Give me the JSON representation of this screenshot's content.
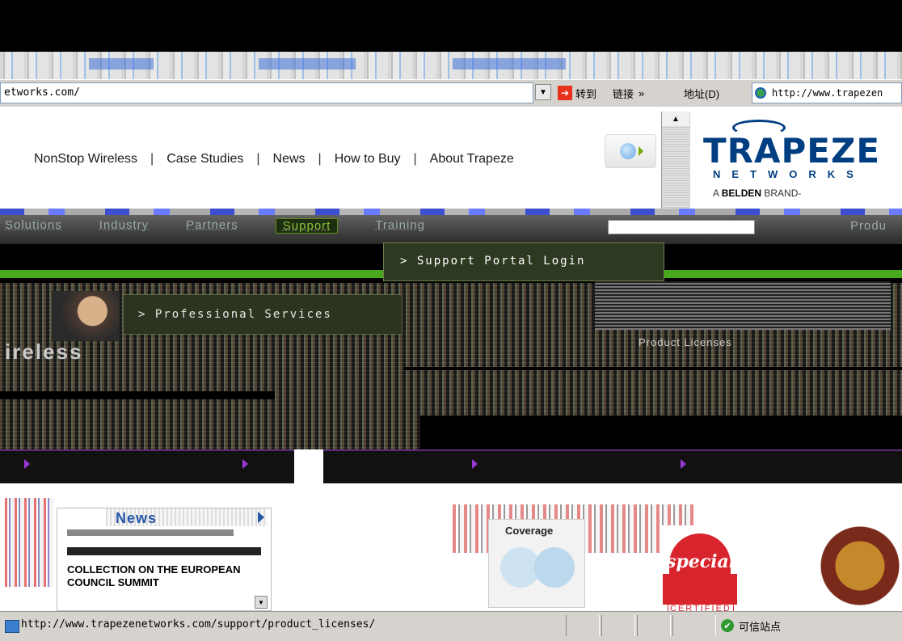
{
  "browser": {
    "address_value": "etworks.com/",
    "go_label": "转到",
    "links_label": "链接",
    "links_chevron": "»",
    "address_label": "地址(D)",
    "address_value_2": "http://www.trapezen",
    "status_text": "http://www.trapezenetworks.com/support/product_licenses/",
    "status_zone": "可信站点"
  },
  "header": {
    "top_nav": [
      "NonStop Wireless",
      "Case Studies",
      "News",
      "How to Buy",
      "About Trapeze"
    ],
    "separator": "|"
  },
  "logo": {
    "word": "TRAPEZE",
    "networks": "NETWORKS",
    "tagline_prefix": "A ",
    "tagline_bold": "BELDEN",
    "tagline_suffix": " BRAND-"
  },
  "main_nav": {
    "items": [
      "Solutions",
      "Industry",
      "Partners",
      "Support",
      "Training"
    ],
    "last": "Produ"
  },
  "menus": {
    "support_portal": "> Support Portal Login",
    "professional_services": "> Professional Services",
    "product_licenses": "Product Licenses"
  },
  "hero": {
    "wireless_fragment": "ireless"
  },
  "news": {
    "title": "News",
    "headline": "COLLECTION ON THE EUROPEAN COUNCIL SUMMIT"
  },
  "promo": {
    "coverage": "Coverage",
    "certified_word": "special",
    "certified_label": "CERTIFIED"
  }
}
